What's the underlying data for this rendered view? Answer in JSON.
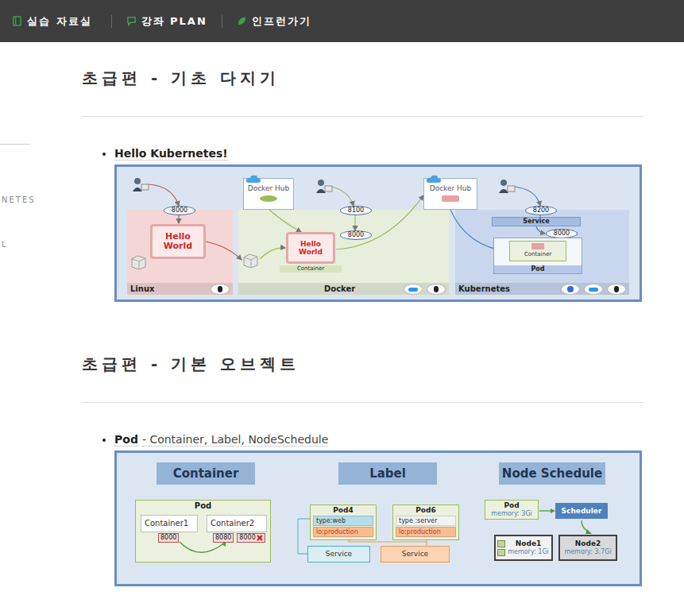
{
  "nav": [
    {
      "label": "실습 자료실"
    },
    {
      "label": "강좌 PLAN"
    },
    {
      "label": "인프런가기"
    }
  ],
  "sidebar": {
    "items": [
      "NETES",
      "L"
    ]
  },
  "sections": [
    {
      "kind": "hello",
      "heading": "초급편 - 기초 다지기",
      "bullet": {
        "title": "Hello Kubernetes!",
        "desc": ""
      }
    },
    {
      "kind": "pod",
      "heading": "초급편 - 기본 오브젝트",
      "bullet": {
        "title": "Pod",
        "desc": "- Container, Label, NodeSchedule"
      }
    }
  ],
  "hello_diagram": {
    "panels": [
      {
        "label": "Linux",
        "color": "#f4d6d6"
      },
      {
        "label": "Docker",
        "color": "#e7eedb"
      },
      {
        "label": "Kubernetes",
        "color": "#c9d7ee"
      }
    ],
    "linux": {
      "port": "8000",
      "app": "Hello World"
    },
    "docker": {
      "hub": "Docker Hub",
      "port_out": "8100",
      "port_in": "8000",
      "app": "Hello World",
      "container": "Container"
    },
    "kubernetes": {
      "hub": "Docker Hub",
      "port_out": "8200",
      "service": "Service",
      "port_in": "8000",
      "container": "Container",
      "pod": "Pod"
    }
  },
  "pod_diagram": {
    "titles": [
      "Container",
      "Label",
      "Node Schedule"
    ],
    "container": {
      "pod": "Pod",
      "containers": [
        {
          "name": "Container1",
          "ports": [
            {
              "port": "8000",
              "blocked": false
            }
          ]
        },
        {
          "name": "Container2",
          "ports": [
            {
              "port": "8080",
              "blocked": false
            },
            {
              "port": "8000",
              "blocked": true
            }
          ]
        }
      ]
    },
    "label": {
      "pods": [
        {
          "name": "Pod4",
          "labels": [
            {
              "text": "type:web",
              "color": "#b7dde8"
            },
            {
              "text": "lo:production",
              "color": "#f9be8f"
            }
          ]
        },
        {
          "name": "Pod6",
          "labels": [
            {
              "text": "type :server",
              "color": "#f2f2f2"
            },
            {
              "text": "lo:production",
              "color": "#f9be8f"
            }
          ]
        }
      ],
      "services": [
        {
          "name": "Service",
          "color": "#daeef3"
        },
        {
          "name": "Service",
          "color": "#fbd5b5"
        }
      ]
    },
    "node_schedule": {
      "pod": {
        "name": "Pod",
        "memory": "memory: 3Gi"
      },
      "scheduler": "Scheduler",
      "nodes": [
        {
          "name": "Node1",
          "memory": "memory: 1Gi",
          "selected": false
        },
        {
          "name": "Node2",
          "memory": "memory: 3.7Gi",
          "selected": true
        }
      ]
    }
  }
}
